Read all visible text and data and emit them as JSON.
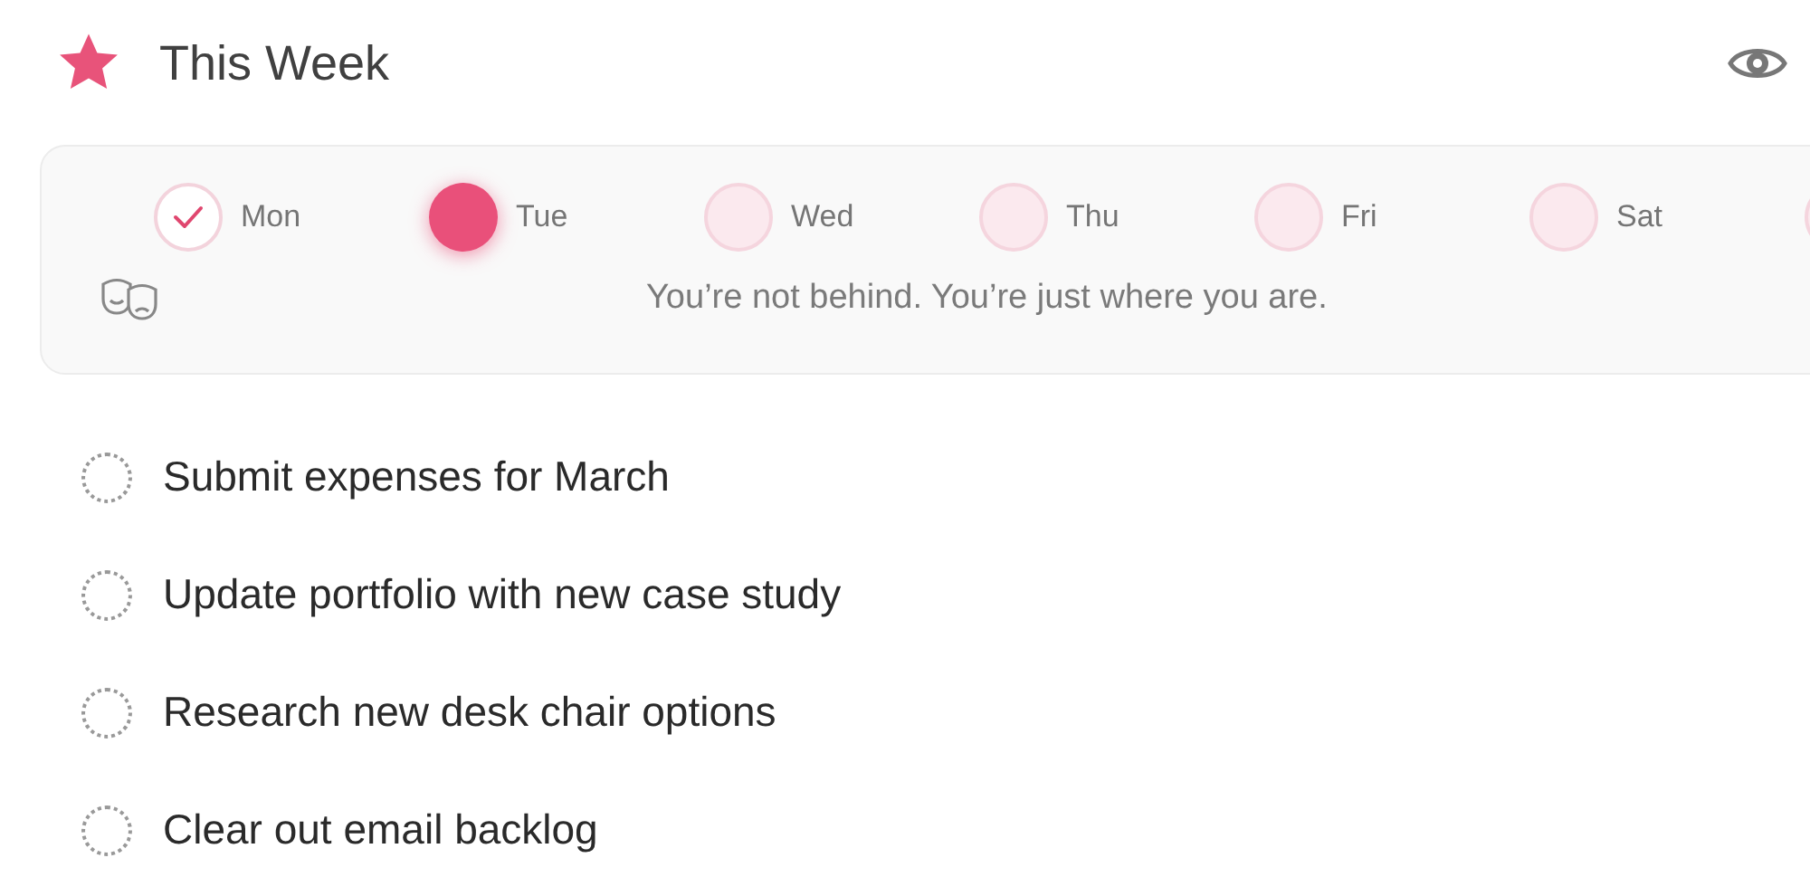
{
  "header": {
    "title": "This Week"
  },
  "week": {
    "days": [
      {
        "label": "Mon",
        "kind": "done"
      },
      {
        "label": "Tue",
        "kind": "today"
      },
      {
        "label": "Wed",
        "kind": "pending"
      },
      {
        "label": "Thu",
        "kind": "pending"
      },
      {
        "label": "Fri",
        "kind": "pending"
      },
      {
        "label": "Sat",
        "kind": "pending"
      },
      {
        "kind": "pending"
      }
    ],
    "quote": "You’re not behind. You’re just where you are."
  },
  "tasks": [
    {
      "label": "Submit expenses for March",
      "checked": false
    },
    {
      "label": "Update portfolio with new case study",
      "checked": false
    },
    {
      "label": "Research new desk chair options",
      "checked": false
    },
    {
      "label": "Clear out email backlog",
      "checked": false
    }
  ]
}
